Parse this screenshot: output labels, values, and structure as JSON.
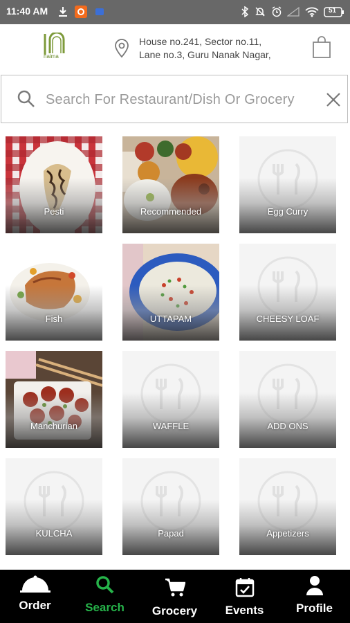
{
  "status_bar": {
    "time": "11:40 AM",
    "battery": "51"
  },
  "header": {
    "logo_text": "naima",
    "address_line1": "House no.241, Sector no.11,",
    "address_line2": "Lane no.3, Guru Nanak Nagar,"
  },
  "search": {
    "placeholder": "Search For Restaurant/Dish Or Grocery"
  },
  "categories": [
    {
      "label": "Pesti"
    },
    {
      "label": "Recommended"
    },
    {
      "label": "Egg Curry"
    },
    {
      "label": "Fish"
    },
    {
      "label": "UTTAPAM"
    },
    {
      "label": "CHEESY LOAF"
    },
    {
      "label": "Manchurian"
    },
    {
      "label": "WAFFLE"
    },
    {
      "label": "ADD ONS"
    },
    {
      "label": "KULCHA"
    },
    {
      "label": "Papad"
    },
    {
      "label": "Appetizers"
    }
  ],
  "nav": [
    {
      "label": "Order",
      "icon": "cloche-icon"
    },
    {
      "label": "Search",
      "icon": "search-icon",
      "active": true
    },
    {
      "label": "Grocery",
      "icon": "cart-icon"
    },
    {
      "label": "Events",
      "icon": "calendar-check-icon"
    },
    {
      "label": "Profile",
      "icon": "person-icon"
    }
  ],
  "colors": {
    "status_bar": "#686868",
    "nav_bg": "#000000",
    "nav_active": "#26b34a",
    "logo_green": "#6a8a2c"
  }
}
